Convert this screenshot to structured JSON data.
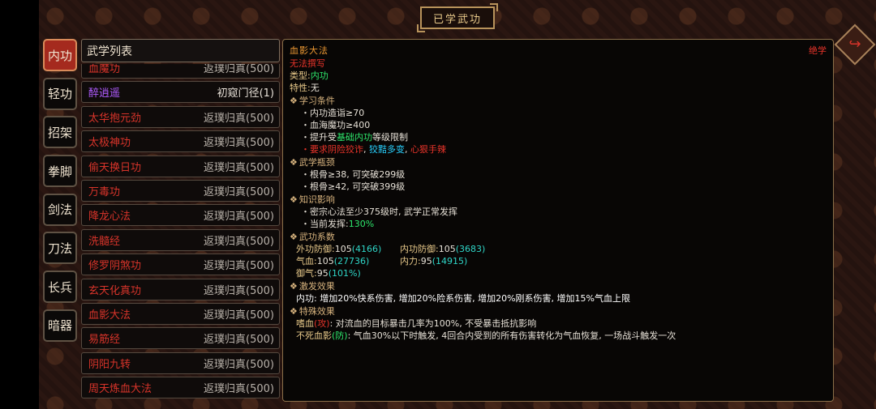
{
  "title": "已学武功",
  "tabs": [
    "内功",
    "轻功",
    "招架",
    "拳脚",
    "剑法",
    "刀法",
    "长兵",
    "暗器"
  ],
  "list_header": "武学列表",
  "skills": [
    {
      "name": "血魔功",
      "status": "返璞归真(500)"
    },
    {
      "name": "醉逍遥",
      "status": "初窥门径(1)"
    },
    {
      "name": "太华抱元劲",
      "status": "返璞归真(500)"
    },
    {
      "name": "太极神功",
      "status": "返璞归真(500)"
    },
    {
      "name": "偷天换日功",
      "status": "返璞归真(500)"
    },
    {
      "name": "万毒功",
      "status": "返璞归真(500)"
    },
    {
      "name": "降龙心法",
      "status": "返璞归真(500)"
    },
    {
      "name": "洗髓经",
      "status": "返璞归真(500)"
    },
    {
      "name": "修罗阴煞功",
      "status": "返璞归真(500)"
    },
    {
      "name": "玄天化真功",
      "status": "返璞归真(500)"
    },
    {
      "name": "血影大法",
      "status": "返璞归真(500)"
    },
    {
      "name": "易筋经",
      "status": "返璞归真(500)"
    },
    {
      "name": "阴阳九转",
      "status": "返璞归真(500)"
    },
    {
      "name": "周天炼血大法",
      "status": "返璞归真(500)"
    }
  ],
  "detail": {
    "name": "血影大法",
    "grade": "绝学",
    "cannot_write": "无法撰写",
    "type_label": "类型:",
    "type_value": "内功",
    "trait_label": "特性:",
    "trait_value": "无",
    "sec_learn": "学习条件",
    "learn1": "・内功造诣≥70",
    "learn2": "・血海魔功≥400",
    "learn3_a": "・提升受",
    "learn3_b": "基础内功",
    "learn3_c": "等级限制",
    "learn4_a": "・要求",
    "learn4_b": "阴险狡诈",
    "learn4_c": "狡黠多变",
    "learn4_d": "心狠手辣",
    "sec_neck": "武学瓶颈",
    "neck1": "・根骨≥38, 可突破299级",
    "neck2": "・根骨≥42, 可突破399级",
    "sec_know": "知识影响",
    "know1": "・密宗心法至少375级时, 武学正常发挥",
    "know2_a": "・当前发挥:",
    "know2_b": "130%",
    "sec_coef": "武功系数",
    "coef_ext_label": "外功防御:",
    "coef_ext_val": "105",
    "coef_ext_paren": "(4166)",
    "coef_int_label": "内功防御:",
    "coef_int_val": "105",
    "coef_int_paren": "(3683)",
    "coef_qi_label": "气血:",
    "coef_qi_val": "105",
    "coef_qi_paren": "(27736)",
    "coef_neili_label": "内力:",
    "coef_neili_val": "95",
    "coef_neili_paren": "(14915)",
    "coef_yu_label": "御气:",
    "coef_yu_val": "95",
    "coef_yu_paren": "(101%)",
    "sec_effect": "激发效果",
    "effect1": "内功: 增加20%快系伤害, 增加20%险系伤害, 增加20%刚系伤害, 增加15%气血上限",
    "sec_special": "特殊效果",
    "sp1_name": "嗜血",
    "sp1_tag": "(攻)",
    "sp1_text": ": 对流血的目标暴击几率为100%, 不受暴击抵抗影响",
    "sp2_name": "不死血影",
    "sp2_tag": "(防)",
    "sp2_text": ": 气血30%以下时触发, 4回合内受到的所有伤害转化为气血恢复, 一场战斗触发一次"
  },
  "colors": {
    "active_tab": "#a52a1e",
    "skill_name_red": "#d8342a",
    "skill_name_purple": "#b05cff",
    "gold": "#e8c98a",
    "green": "#2ee66b",
    "cyan": "#29d1ff"
  },
  "icons": {
    "corner_button": "return-arrow-icon",
    "section_marker": "diamond-icon"
  }
}
